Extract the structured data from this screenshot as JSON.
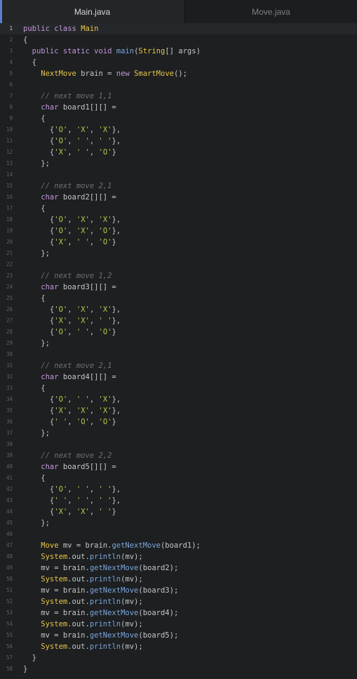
{
  "tabs": [
    {
      "label": "Main.java",
      "active": true
    },
    {
      "label": "Move.java",
      "active": false
    }
  ],
  "colors": {
    "background": "#1d1f21",
    "keyword": "#c397d8",
    "class_name": "#e7c547",
    "method": "#7aa6da",
    "string": "#b9ca4a",
    "comment": "#6b7178",
    "plain": "#c5c8c6",
    "line_number": "#5c6166"
  },
  "editor": {
    "active_line": 1,
    "lines": [
      [
        [
          "kw",
          "public class "
        ],
        [
          "cls",
          "Main"
        ]
      ],
      [
        [
          "p",
          "{"
        ]
      ],
      [
        [
          "kw",
          "  public static void "
        ],
        [
          "fn",
          "main"
        ],
        [
          "p",
          "("
        ],
        [
          "cls",
          "String"
        ],
        [
          "p",
          "[] args)"
        ]
      ],
      [
        [
          "p",
          "  {"
        ]
      ],
      [
        [
          "cls",
          "    NextMove"
        ],
        [
          "p",
          " brain = "
        ],
        [
          "kw",
          "new "
        ],
        [
          "cls",
          "SmartMove"
        ],
        [
          "p",
          "();"
        ]
      ],
      [],
      [
        [
          "cmt",
          "    // next move 1,1"
        ]
      ],
      [
        [
          "kw",
          "    char"
        ],
        [
          "p",
          " board1[][] ="
        ]
      ],
      [
        [
          "p",
          "    {"
        ]
      ],
      [
        [
          "p",
          "      {"
        ],
        [
          "str",
          "'O'"
        ],
        [
          "p",
          ", "
        ],
        [
          "str",
          "'X'"
        ],
        [
          "p",
          ", "
        ],
        [
          "str",
          "'X'"
        ],
        [
          "p",
          "},"
        ]
      ],
      [
        [
          "p",
          "      {"
        ],
        [
          "str",
          "'O'"
        ],
        [
          "p",
          ", "
        ],
        [
          "str",
          "' '"
        ],
        [
          "p",
          ", "
        ],
        [
          "str",
          "' '"
        ],
        [
          "p",
          "},"
        ]
      ],
      [
        [
          "p",
          "      {"
        ],
        [
          "str",
          "'X'"
        ],
        [
          "p",
          ", "
        ],
        [
          "str",
          "' '"
        ],
        [
          "p",
          ", "
        ],
        [
          "str",
          "'O'"
        ],
        [
          "p",
          "}"
        ]
      ],
      [
        [
          "p",
          "    };"
        ]
      ],
      [],
      [
        [
          "cmt",
          "    // next move 2,1"
        ]
      ],
      [
        [
          "kw",
          "    char"
        ],
        [
          "p",
          " board2[][] ="
        ]
      ],
      [
        [
          "p",
          "    {"
        ]
      ],
      [
        [
          "p",
          "      {"
        ],
        [
          "str",
          "'O'"
        ],
        [
          "p",
          ", "
        ],
        [
          "str",
          "'X'"
        ],
        [
          "p",
          ", "
        ],
        [
          "str",
          "'X'"
        ],
        [
          "p",
          "},"
        ]
      ],
      [
        [
          "p",
          "      {"
        ],
        [
          "str",
          "'O'"
        ],
        [
          "p",
          ", "
        ],
        [
          "str",
          "'X'"
        ],
        [
          "p",
          ", "
        ],
        [
          "str",
          "'O'"
        ],
        [
          "p",
          "},"
        ]
      ],
      [
        [
          "p",
          "      {"
        ],
        [
          "str",
          "'X'"
        ],
        [
          "p",
          ", "
        ],
        [
          "str",
          "' '"
        ],
        [
          "p",
          ", "
        ],
        [
          "str",
          "'O'"
        ],
        [
          "p",
          "}"
        ]
      ],
      [
        [
          "p",
          "    };"
        ]
      ],
      [],
      [
        [
          "cmt",
          "    // next move 1,2"
        ]
      ],
      [
        [
          "kw",
          "    char"
        ],
        [
          "p",
          " board3[][] ="
        ]
      ],
      [
        [
          "p",
          "    {"
        ]
      ],
      [
        [
          "p",
          "      {"
        ],
        [
          "str",
          "'O'"
        ],
        [
          "p",
          ", "
        ],
        [
          "str",
          "'X'"
        ],
        [
          "p",
          ", "
        ],
        [
          "str",
          "'X'"
        ],
        [
          "p",
          "},"
        ]
      ],
      [
        [
          "p",
          "      {"
        ],
        [
          "str",
          "'X'"
        ],
        [
          "p",
          ", "
        ],
        [
          "str",
          "'X'"
        ],
        [
          "p",
          ", "
        ],
        [
          "str",
          "' '"
        ],
        [
          "p",
          "},"
        ]
      ],
      [
        [
          "p",
          "      {"
        ],
        [
          "str",
          "'O'"
        ],
        [
          "p",
          ", "
        ],
        [
          "str",
          "' '"
        ],
        [
          "p",
          ", "
        ],
        [
          "str",
          "'O'"
        ],
        [
          "p",
          "}"
        ]
      ],
      [
        [
          "p",
          "    };"
        ]
      ],
      [],
      [
        [
          "cmt",
          "    // next move 2,1"
        ]
      ],
      [
        [
          "kw",
          "    char"
        ],
        [
          "p",
          " board4[][] ="
        ]
      ],
      [
        [
          "p",
          "    {"
        ]
      ],
      [
        [
          "p",
          "      {"
        ],
        [
          "str",
          "'O'"
        ],
        [
          "p",
          ", "
        ],
        [
          "str",
          "' '"
        ],
        [
          "p",
          ", "
        ],
        [
          "str",
          "'X'"
        ],
        [
          "p",
          "},"
        ]
      ],
      [
        [
          "p",
          "      {"
        ],
        [
          "str",
          "'X'"
        ],
        [
          "p",
          ", "
        ],
        [
          "str",
          "'X'"
        ],
        [
          "p",
          ", "
        ],
        [
          "str",
          "'X'"
        ],
        [
          "p",
          "},"
        ]
      ],
      [
        [
          "p",
          "      {"
        ],
        [
          "str",
          "' '"
        ],
        [
          "p",
          ", "
        ],
        [
          "str",
          "'O'"
        ],
        [
          "p",
          ", "
        ],
        [
          "str",
          "'O'"
        ],
        [
          "p",
          "}"
        ]
      ],
      [
        [
          "p",
          "    };"
        ]
      ],
      [],
      [
        [
          "cmt",
          "    // next move 2,2"
        ]
      ],
      [
        [
          "kw",
          "    char"
        ],
        [
          "p",
          " board5[][] ="
        ]
      ],
      [
        [
          "p",
          "    {"
        ]
      ],
      [
        [
          "p",
          "      {"
        ],
        [
          "str",
          "'O'"
        ],
        [
          "p",
          ", "
        ],
        [
          "str",
          "' '"
        ],
        [
          "p",
          ", "
        ],
        [
          "str",
          "' '"
        ],
        [
          "p",
          "},"
        ]
      ],
      [
        [
          "p",
          "      {"
        ],
        [
          "str",
          "' '"
        ],
        [
          "p",
          ", "
        ],
        [
          "str",
          "' '"
        ],
        [
          "p",
          ", "
        ],
        [
          "str",
          "' '"
        ],
        [
          "p",
          "},"
        ]
      ],
      [
        [
          "p",
          "      {"
        ],
        [
          "str",
          "'X'"
        ],
        [
          "p",
          ", "
        ],
        [
          "str",
          "'X'"
        ],
        [
          "p",
          ", "
        ],
        [
          "str",
          "' '"
        ],
        [
          "p",
          "}"
        ]
      ],
      [
        [
          "p",
          "    };"
        ]
      ],
      [],
      [
        [
          "cls",
          "    Move"
        ],
        [
          "p",
          " mv = brain."
        ],
        [
          "fn",
          "getNextMove"
        ],
        [
          "p",
          "(board1);"
        ]
      ],
      [
        [
          "cls",
          "    System"
        ],
        [
          "p",
          ".out."
        ],
        [
          "fn",
          "println"
        ],
        [
          "p",
          "(mv);"
        ]
      ],
      [
        [
          "p",
          "    mv = brain."
        ],
        [
          "fn",
          "getNextMove"
        ],
        [
          "p",
          "(board2);"
        ]
      ],
      [
        [
          "cls",
          "    System"
        ],
        [
          "p",
          ".out."
        ],
        [
          "fn",
          "println"
        ],
        [
          "p",
          "(mv);"
        ]
      ],
      [
        [
          "p",
          "    mv = brain."
        ],
        [
          "fn",
          "getNextMove"
        ],
        [
          "p",
          "(board3);"
        ]
      ],
      [
        [
          "cls",
          "    System"
        ],
        [
          "p",
          ".out."
        ],
        [
          "fn",
          "println"
        ],
        [
          "p",
          "(mv);"
        ]
      ],
      [
        [
          "p",
          "    mv = brain."
        ],
        [
          "fn",
          "getNextMove"
        ],
        [
          "p",
          "(board4);"
        ]
      ],
      [
        [
          "cls",
          "    System"
        ],
        [
          "p",
          ".out."
        ],
        [
          "fn",
          "println"
        ],
        [
          "p",
          "(mv);"
        ]
      ],
      [
        [
          "p",
          "    mv = brain."
        ],
        [
          "fn",
          "getNextMove"
        ],
        [
          "p",
          "(board5);"
        ]
      ],
      [
        [
          "cls",
          "    System"
        ],
        [
          "p",
          ".out."
        ],
        [
          "fn",
          "println"
        ],
        [
          "p",
          "(mv);"
        ]
      ],
      [
        [
          "p",
          "  }"
        ]
      ],
      [
        [
          "p",
          "}"
        ]
      ]
    ]
  }
}
